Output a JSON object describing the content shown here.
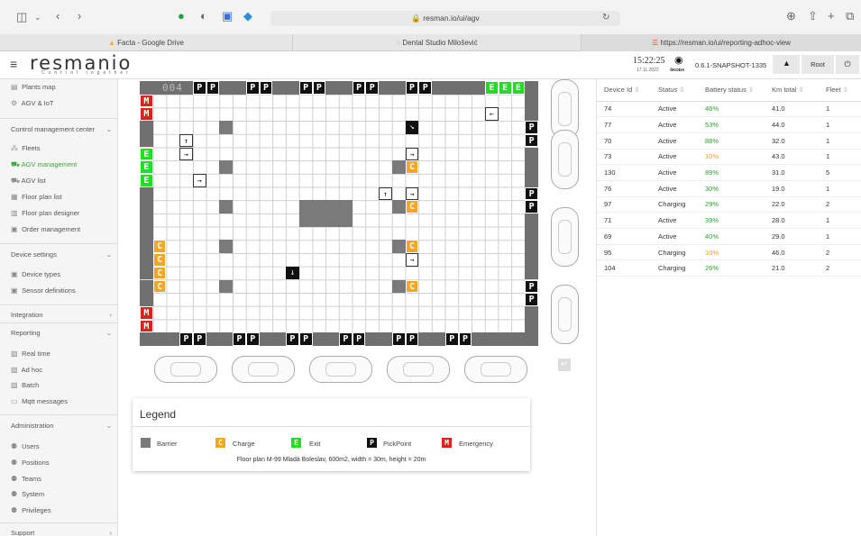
{
  "browser": {
    "url": "resman.io/ui/agv",
    "tabs": [
      "Facta - Google Drive",
      "Dental Studio Milošević",
      "https://resman.io/ui/reporting-adhoc-view"
    ]
  },
  "header": {
    "logo": "resmanio",
    "tagline": "Control together",
    "time": "15:22:25",
    "date": "17.11.2022",
    "brand": "ŠKODA",
    "version": "0.6.1-SNAPSHOT-1335",
    "user": "Root"
  },
  "sidebar": {
    "top_items": [
      {
        "label": "Plants map",
        "icon": "map-icon"
      },
      {
        "label": "AGV & IoT",
        "icon": "iot-icon"
      }
    ],
    "sections": [
      {
        "title": "Control management center",
        "items": [
          "Fleets",
          "AGV management",
          "AGV list",
          "Floor plan list",
          "Floor plan designer",
          "Order management"
        ]
      },
      {
        "title": "Device settings",
        "items": [
          "Device types",
          "Sensor definitions"
        ]
      },
      {
        "title": "Integration",
        "items": []
      },
      {
        "title": "Reporting",
        "items": [
          "Real time",
          "Ad hoc",
          "Batch",
          "Mqtt messages"
        ]
      },
      {
        "title": "Administration",
        "items": [
          "Users",
          "Positions",
          "Teams",
          "System",
          "Privileges"
        ]
      },
      {
        "title": "Support",
        "items": []
      }
    ]
  },
  "map": {
    "number": "004",
    "legend_title": "Legend",
    "legend": [
      {
        "key": "B",
        "label": "Barrier",
        "color": "#7a7a7a"
      },
      {
        "key": "C",
        "label": "Charge",
        "color": "#f5a623"
      },
      {
        "key": "E",
        "label": "Exit",
        "color": "#22dd22"
      },
      {
        "key": "P",
        "label": "PickPoint",
        "color": "#111111"
      },
      {
        "key": "M",
        "label": "Emergency",
        "color": "#d9241c"
      }
    ],
    "caption": "Floor plan M-99 Mladá Boleslav, 600m2, width = 30m, height = 20m"
  },
  "table": {
    "headers": [
      "Device Id",
      "Status",
      "Battery status",
      "Km total",
      "Fleet"
    ],
    "rows": [
      [
        "74",
        "Active",
        "46%",
        "41.0",
        "1"
      ],
      [
        "77",
        "Active",
        "53%",
        "44.0",
        "1"
      ],
      [
        "70",
        "Active",
        "88%",
        "32.0",
        "1"
      ],
      [
        "73",
        "Active",
        "10%",
        "43.0",
        "1"
      ],
      [
        "130",
        "Active",
        "89%",
        "31.0",
        "5"
      ],
      [
        "76",
        "Active",
        "30%",
        "19.0",
        "1"
      ],
      [
        "97",
        "Charging",
        "29%",
        "22.0",
        "2"
      ],
      [
        "71",
        "Active",
        "39%",
        "28.0",
        "1"
      ],
      [
        "69",
        "Active",
        "40%",
        "29.0",
        "1"
      ],
      [
        "95",
        "Charging",
        "10%",
        "46.0",
        "2"
      ],
      [
        "104",
        "Charging",
        "26%",
        "21.0",
        "2"
      ]
    ]
  }
}
